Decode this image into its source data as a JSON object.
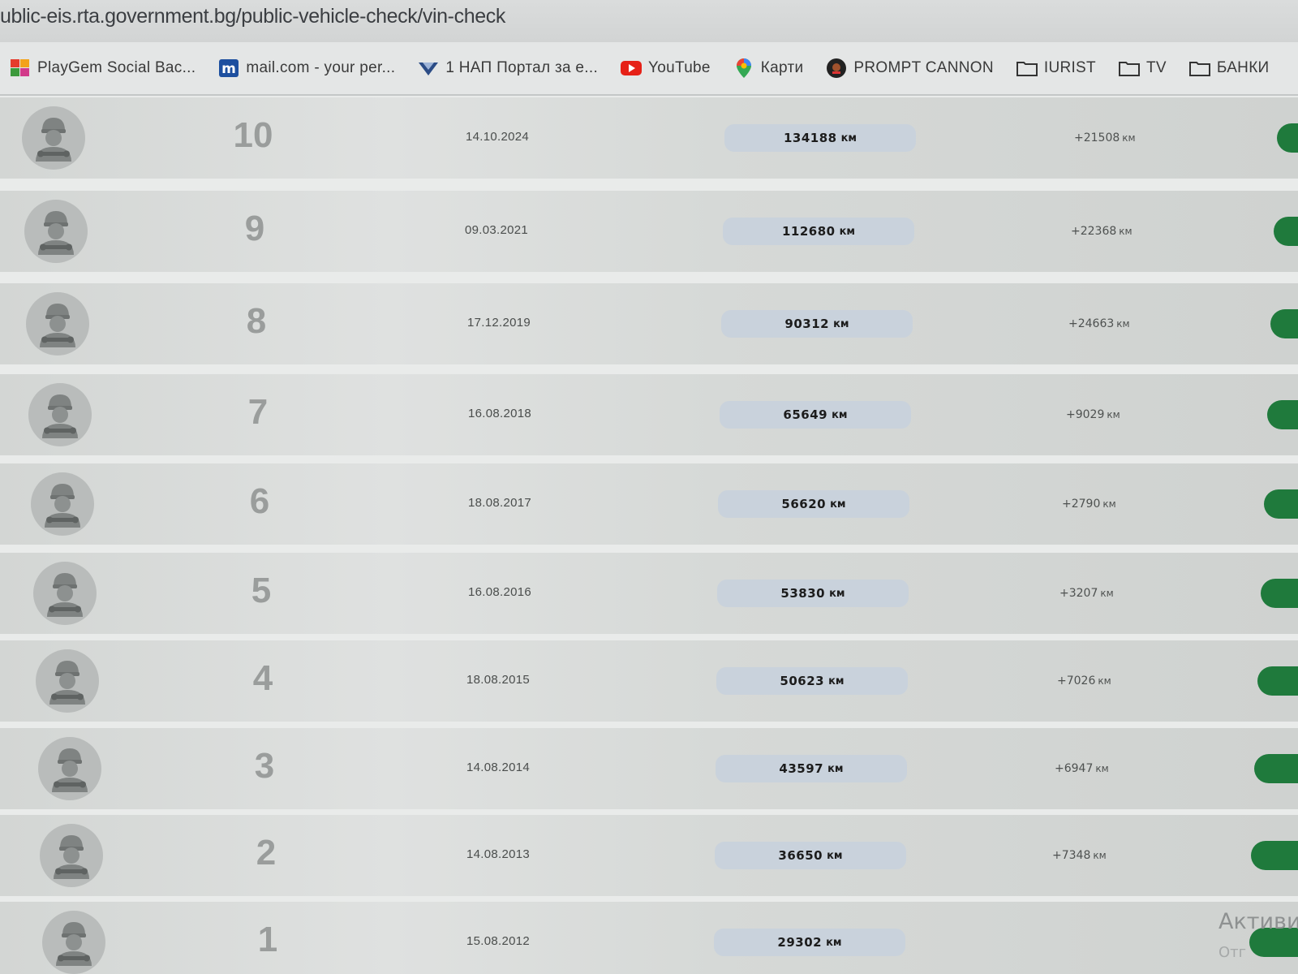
{
  "browser": {
    "url": "ublic-eis.rta.government.bg/public-vehicle-check/vin-check",
    "bookmarks": [
      {
        "label": "PlayGem Social Bac...",
        "icon": "playgem-icon"
      },
      {
        "label": "mail.com - your per...",
        "icon": "mailcom-icon"
      },
      {
        "label": "1 НАП Портал за е...",
        "icon": "nap-icon"
      },
      {
        "label": "YouTube",
        "icon": "youtube-icon"
      },
      {
        "label": "Карти",
        "icon": "maps-pin-icon"
      },
      {
        "label": "PROMPT CANNON",
        "icon": "prompt-cannon-icon"
      },
      {
        "label": "IURIST",
        "icon": "folder-icon"
      },
      {
        "label": "TV",
        "icon": "folder-icon"
      },
      {
        "label": "БАНКИ",
        "icon": "folder-icon"
      }
    ]
  },
  "history": {
    "km_unit": "км",
    "rows": [
      {
        "index": "10",
        "date": "14.10.2024",
        "km": "134188",
        "diff": "+21508"
      },
      {
        "index": "9",
        "date": "09.03.2021",
        "km": "112680",
        "diff": "+22368"
      },
      {
        "index": "8",
        "date": "17.12.2019",
        "km": "90312",
        "diff": "+24663"
      },
      {
        "index": "7",
        "date": "16.08.2018",
        "km": "65649",
        "diff": "+9029"
      },
      {
        "index": "6",
        "date": "18.08.2017",
        "km": "56620",
        "diff": "+2790"
      },
      {
        "index": "5",
        "date": "16.08.2016",
        "km": "53830",
        "diff": "+3207"
      },
      {
        "index": "4",
        "date": "18.08.2015",
        "km": "50623",
        "diff": "+7026"
      },
      {
        "index": "3",
        "date": "14.08.2014",
        "km": "43597",
        "diff": "+6947"
      },
      {
        "index": "2",
        "date": "14.08.2013",
        "km": "36650",
        "diff": "+7348"
      },
      {
        "index": "1",
        "date": "15.08.2012",
        "km": "29302",
        "diff": ""
      }
    ]
  },
  "watermark": {
    "line1": "Активи",
    "line2": "Отг"
  },
  "colors": {
    "status": "#1f7a3c",
    "km_pill": "#c9d2dc",
    "youtube": "#e62117"
  }
}
